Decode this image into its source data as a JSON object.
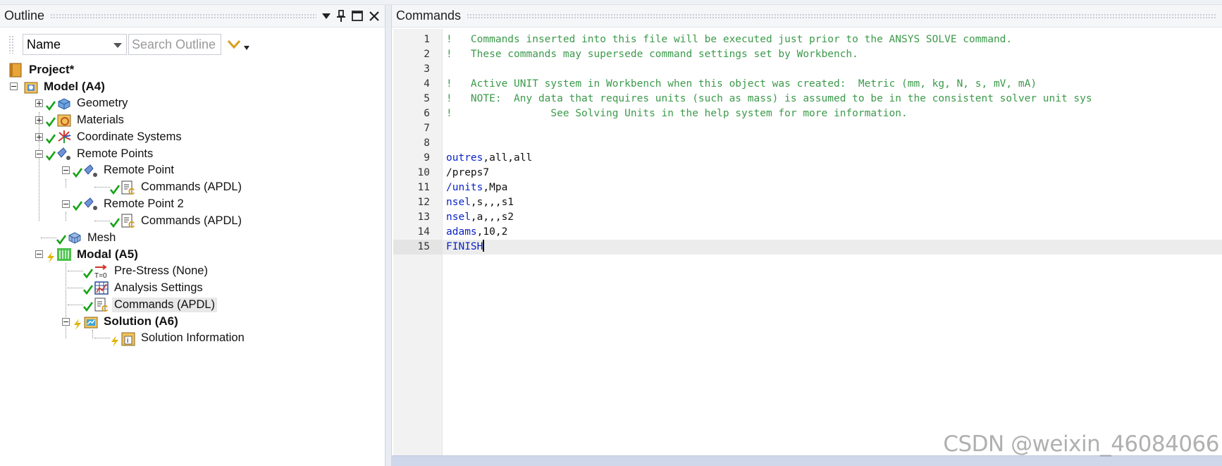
{
  "outline": {
    "title": "Outline",
    "name_select": "Name",
    "search_placeholder": "Search Outline",
    "tree": [
      {
        "label": "Project*",
        "bold": true,
        "icon": "project-icon",
        "status": ""
      },
      {
        "label": "Model (A4)",
        "bold": true,
        "icon": "model-icon",
        "status": ""
      },
      {
        "label": "Geometry",
        "bold": false,
        "icon": "geometry-icon",
        "status": "check"
      },
      {
        "label": "Materials",
        "bold": false,
        "icon": "materials-icon",
        "status": "check"
      },
      {
        "label": "Coordinate Systems",
        "bold": false,
        "icon": "coordinate-systems-icon",
        "status": "check"
      },
      {
        "label": "Remote Points",
        "bold": false,
        "icon": "remote-points-icon",
        "status": "check"
      },
      {
        "label": "Remote Point",
        "bold": false,
        "icon": "remote-point-icon",
        "status": "check"
      },
      {
        "label": "Commands (APDL)",
        "bold": false,
        "icon": "commands-icon",
        "status": "check"
      },
      {
        "label": "Remote Point 2",
        "bold": false,
        "icon": "remote-point-icon",
        "status": "check"
      },
      {
        "label": "Commands (APDL)",
        "bold": false,
        "icon": "commands-icon",
        "status": "check"
      },
      {
        "label": "Mesh",
        "bold": false,
        "icon": "mesh-icon",
        "status": "check"
      },
      {
        "label": "Modal (A5)",
        "bold": true,
        "icon": "modal-icon",
        "status": "lightning"
      },
      {
        "label": "Pre-Stress (None)",
        "bold": false,
        "icon": "prestress-icon",
        "status": "check"
      },
      {
        "label": "Analysis Settings",
        "bold": false,
        "icon": "analysis-settings-icon",
        "status": "check"
      },
      {
        "label": "Commands (APDL)",
        "bold": false,
        "icon": "commands-icon",
        "status": "check",
        "selected": true
      },
      {
        "label": "Solution (A6)",
        "bold": true,
        "icon": "solution-icon",
        "status": "lightning"
      },
      {
        "label": "Solution Information",
        "bold": false,
        "icon": "solution-information-icon",
        "status": "lightning"
      }
    ]
  },
  "commands": {
    "title": "Commands",
    "lines": [
      {
        "n": "1",
        "text": "!   Commands inserted into this file will be executed just prior to the ANSYS SOLVE command.",
        "kind": "comment"
      },
      {
        "n": "2",
        "text": "!   These commands may supersede command settings set by Workbench.",
        "kind": "comment"
      },
      {
        "n": "3",
        "text": "",
        "kind": "comment"
      },
      {
        "n": "4",
        "text": "!   Active UNIT system in Workbench when this object was created:  Metric (mm, kg, N, s, mV, mA)",
        "kind": "comment"
      },
      {
        "n": "5",
        "text": "!   NOTE:  Any data that requires units (such as mass) is assumed to be in the consistent solver unit sys",
        "kind": "comment"
      },
      {
        "n": "6",
        "text": "!                See Solving Units in the help system for more information.",
        "kind": "comment"
      },
      {
        "n": "7",
        "text": "",
        "kind": "comment"
      },
      {
        "n": "8",
        "text": "",
        "kind": "comment"
      },
      {
        "n": "9",
        "cmd": "outres",
        "args": ",all,all",
        "kind": "code"
      },
      {
        "n": "10",
        "cmd": "",
        "args": "/preps7",
        "kind": "code"
      },
      {
        "n": "11",
        "cmd": "/units",
        "args": ",Mpa",
        "kind": "code"
      },
      {
        "n": "12",
        "cmd": "nsel",
        "args": ",s,,,s1",
        "kind": "code"
      },
      {
        "n": "13",
        "cmd": "nsel",
        "args": ",a,,,s2",
        "kind": "code"
      },
      {
        "n": "14",
        "cmd": "adams",
        "args": ",10,2",
        "kind": "code"
      },
      {
        "n": "15",
        "cmd": "FINISH",
        "args": "",
        "kind": "code",
        "current": true
      }
    ]
  },
  "watermark": "CSDN @weixin_46084066",
  "colors": {
    "comment": "#3c9a4b",
    "keyword": "#0a24c8",
    "plain": "#111111",
    "check": "#16a316",
    "lightning": "#e0b400"
  }
}
